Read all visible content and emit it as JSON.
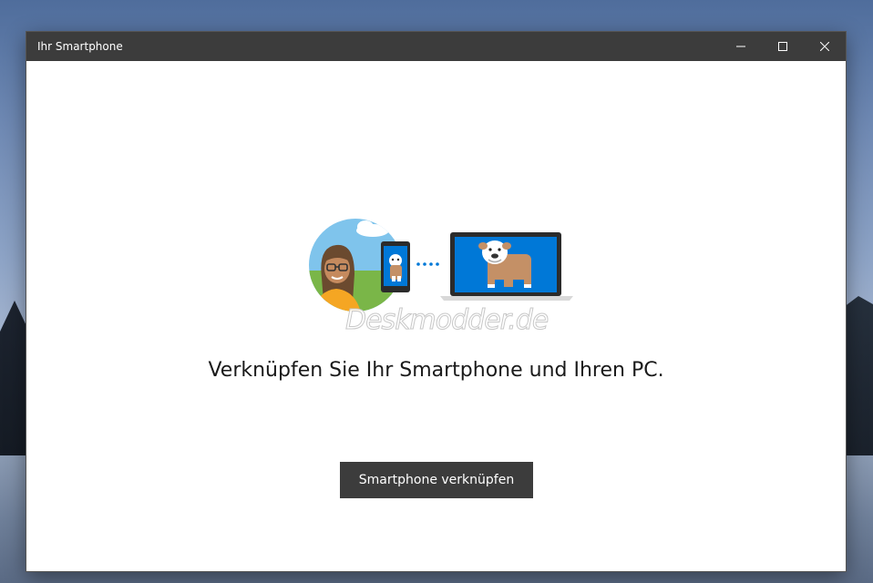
{
  "window": {
    "title": "Ihr Smartphone"
  },
  "content": {
    "watermark": "Deskmodder.de",
    "heading": "Verknüpfen Sie Ihr Smartphone und Ihren PC.",
    "link_button_label": "Smartphone verknüpfen"
  },
  "colors": {
    "titlebar": "#3c3c3c",
    "button": "#3c3c3c",
    "accent_blue": "#0078d7"
  }
}
